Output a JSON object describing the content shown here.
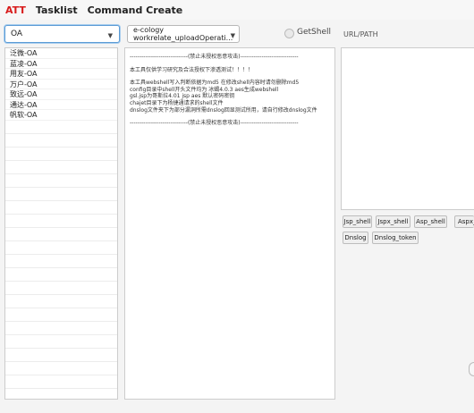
{
  "menu": {
    "items": [
      {
        "label": "ATT"
      },
      {
        "label": "Tasklist"
      },
      {
        "label": "Command Create"
      }
    ]
  },
  "oa_select": {
    "value": "OA"
  },
  "exploit_select": {
    "value": "e-cology workrelate_uploadOperati..."
  },
  "getshell": {
    "label": "GetShell",
    "checked": false
  },
  "url": {
    "label": "URL/PATH"
  },
  "oa_list": [
    "泛微-OA",
    "蓝凌-OA",
    "用友-OA",
    "万户-OA",
    "致远-OA",
    "通达-OA",
    "帆软-OA"
  ],
  "info_text": {
    "line1": "------------------------------(禁止未授权恶意攻击)------------------------------",
    "line2": "本工具仅供学习研究及合法授权下渗透测试！！！！",
    "line3": "本工具webshell写入判断依据为md5 在修改shell内容时请勿删除md5",
    "line4": "config目录中shell开头文件均为 冰蝎4.0.3 aes生成webshell",
    "line5": "gsl.jsp为哥斯拉4.01 jsp aes 默认密码密钥",
    "line6": "chajet目录下为杨捷通请求的shell文件",
    "line7": "dnslog文件夹下为部分漏洞所需dnslog回显测试所用，请自行修改dnslog文件",
    "line8": "------------------------------(禁止未授权恶意攻击)------------------------------"
  },
  "buttons": {
    "jsp_shell": "Jsp_shell",
    "jspx_shell": "Jspx_shell",
    "asp_shell": "Asp_shell",
    "aspx_shell": "Aspx_",
    "dnslog": "Dnslog",
    "dnslog_token": "Dnslog_token"
  },
  "colors": {
    "accent_red": "#d81b1b",
    "focus_blue": "#5b9bd5"
  }
}
